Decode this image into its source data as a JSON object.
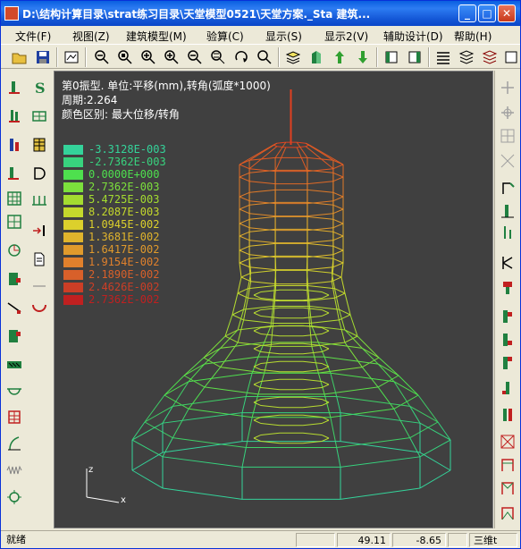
{
  "window": {
    "title": "D:\\结构计算目录\\strat练习目录\\天堂模型0521\\天堂方案._Sta   建筑...",
    "min": "_",
    "max": "□",
    "close": "✕"
  },
  "menu": [
    {
      "label": "文件(F)"
    },
    {
      "label": "视图(Z)"
    },
    {
      "label": "建筑模型(M)"
    },
    {
      "label": "验算(C)"
    },
    {
      "label": "显示(S)"
    },
    {
      "label": "显示2(V)"
    },
    {
      "label": "辅助设计(D)"
    },
    {
      "label": "帮助(H)"
    }
  ],
  "info": {
    "line1": "第0振型. 单位:平移(mm),转角(弧度*1000)",
    "line2": "周期:2.264",
    "line3": "颜色区别: 最大位移/转角"
  },
  "legend": [
    {
      "value": "-3.3128E-003",
      "color": "#34d39a"
    },
    {
      "value": "-2.7362E-003",
      "color": "#38d37e"
    },
    {
      "value": "0.0000E+000",
      "color": "#4ee04e"
    },
    {
      "value": "2.7362E-003",
      "color": "#7ce03c"
    },
    {
      "value": "5.4725E-003",
      "color": "#a4dc30"
    },
    {
      "value": "8.2087E-003",
      "color": "#c4d82c"
    },
    {
      "value": "1.0945E-002",
      "color": "#dcd02c"
    },
    {
      "value": "1.3681E-002",
      "color": "#e0b42c"
    },
    {
      "value": "1.6417E-002",
      "color": "#e09a2c"
    },
    {
      "value": "1.9154E-002",
      "color": "#e0802c"
    },
    {
      "value": "2.1890E-002",
      "color": "#d8602a"
    },
    {
      "value": "2.4626E-002",
      "color": "#cc3e26"
    },
    {
      "value": "2.7362E-002",
      "color": "#c02020"
    }
  ],
  "axes": {
    "x": "x",
    "z": "z"
  },
  "status": {
    "ready": "就绪",
    "coord_x": "49.11",
    "coord_y": "-8.65",
    "view": "三维t"
  },
  "colors": {
    "accent": "#0a46c8",
    "canvas": "#404040"
  }
}
